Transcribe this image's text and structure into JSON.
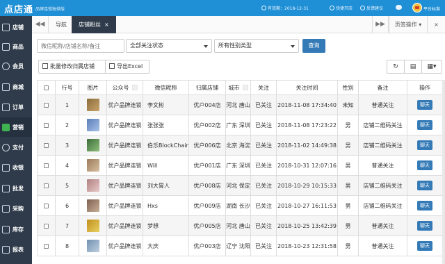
{
  "header": {
    "logo": "点店通",
    "logo_sub": "品牌连锁独供版",
    "expiry": "有效期：2018-12-31",
    "quick_store": "快捷开店",
    "feedback": "反馈建议",
    "username": "平台标准"
  },
  "sidebar": [
    {
      "label": "店铺"
    },
    {
      "label": "商品"
    },
    {
      "label": "会员"
    },
    {
      "label": "商城"
    },
    {
      "label": "订单"
    },
    {
      "label": "营销"
    },
    {
      "label": "支付"
    },
    {
      "label": "收银"
    },
    {
      "label": "批发"
    },
    {
      "label": "采购"
    },
    {
      "label": "库存"
    },
    {
      "label": "报表"
    }
  ],
  "tabs": {
    "prev": "◀◀",
    "nav": "导航",
    "active": "店铺粉丝",
    "close": "×",
    "next": "▶▶",
    "page_ops": "页签操作",
    "close_all": "×"
  },
  "filters": {
    "search_placeholder": "微信昵称/店铺名称/备注",
    "follow_status": "全部关注状态",
    "gender_type": "所有性别类型",
    "query": "查询",
    "batch_edit": "批量修改归属店铺",
    "export": "导出Excel"
  },
  "table": {
    "headers": [
      "行号",
      "图片",
      "公众号",
      "微信昵称",
      "归属店铺",
      "城市",
      "关注",
      "关注时间",
      "性别",
      "备注",
      "操作"
    ],
    "action_label": "聊天",
    "rows": [
      {
        "no": "1",
        "account": "优户品牌连锁",
        "nickname": "李文彬",
        "store": "优户004店",
        "city": "河北 唐山",
        "follow": "已关注",
        "time": "2018-11-08 17:34:40",
        "gender": "未知",
        "remark": "普通关注"
      },
      {
        "no": "2",
        "account": "优户品牌连锁",
        "nickname": "张张张",
        "store": "优户002店",
        "city": "广东 深圳",
        "follow": "已关注",
        "time": "2018-11-08 17:23:22",
        "gender": "男",
        "remark": "店铺二维码关注"
      },
      {
        "no": "3",
        "account": "优户品牌连锁",
        "nickname": "伯乐BlockChain",
        "store": "优户006店",
        "city": "北京 海淀",
        "follow": "已关注",
        "time": "2018-11-02 14:49:38",
        "gender": "男",
        "remark": "店铺二维码关注"
      },
      {
        "no": "4",
        "account": "优户品牌连锁",
        "nickname": "Will",
        "store": "优户001店",
        "city": "广东 深圳",
        "follow": "已关注",
        "time": "2018-10-31 12:07:16",
        "gender": "男",
        "remark": "普通关注"
      },
      {
        "no": "5",
        "account": "优户品牌连锁",
        "nickname": "刘大胃人",
        "store": "优户008店",
        "city": "河北 保定",
        "follow": "已关注",
        "time": "2018-10-29 10:15:33",
        "gender": "男",
        "remark": "店铺二维码关注"
      },
      {
        "no": "6",
        "account": "优户品牌连锁",
        "nickname": "Hxs",
        "store": "优户009店",
        "city": "湖南 长沙",
        "follow": "已关注",
        "time": "2018-10-27 16:11:53",
        "gender": "男",
        "remark": "店铺二维码关注"
      },
      {
        "no": "7",
        "account": "优户品牌连锁",
        "nickname": "梦想",
        "store": "优户005店",
        "city": "河北 唐山",
        "follow": "已关注",
        "time": "2018-10-25 13:42:39",
        "gender": "男",
        "remark": "普通关注"
      },
      {
        "no": "8",
        "account": "优户品牌连锁",
        "nickname": "大庆",
        "store": "优户003店",
        "city": "辽宁 沈阳",
        "follow": "已关注",
        "time": "2018-10-23 12:31:58",
        "gender": "男",
        "remark": "普通关注"
      }
    ]
  },
  "colors": {
    "header_blue": "#1f8fd6",
    "sidebar_bg": "#2f3b4a",
    "primary_btn": "#337ab7",
    "active_green": "#3fb34f"
  }
}
